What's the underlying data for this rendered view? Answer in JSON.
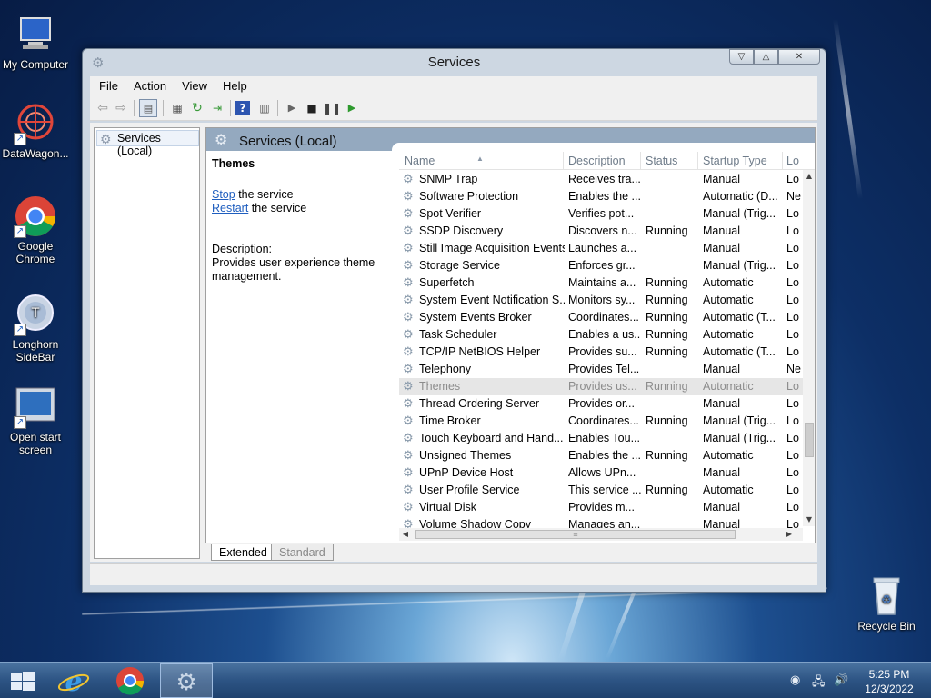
{
  "desktop": {
    "icons": [
      {
        "label": "My Computer",
        "icon": "computer-icon"
      },
      {
        "label": "DataWagon...",
        "icon": "datawagon-icon"
      },
      {
        "label": "Google Chrome",
        "icon": "chrome-icon"
      },
      {
        "label": "Longhorn SideBar",
        "icon": "sidebar-icon"
      },
      {
        "label": "Open start screen",
        "icon": "start-screen-icon"
      },
      {
        "label": "Recycle Bin",
        "icon": "recycle-bin-icon"
      }
    ]
  },
  "window": {
    "title": "Services",
    "menu": [
      "File",
      "Action",
      "View",
      "Help"
    ],
    "toolbar_icons": [
      "back-icon",
      "forward-icon",
      "show-console-tree-icon",
      "properties-icon",
      "refresh-icon",
      "export-list-icon",
      "help-icon",
      "view-icon",
      "play-icon",
      "stop-icon",
      "pause-icon",
      "resume-icon"
    ]
  },
  "tree": {
    "root_label": "Services (Local)"
  },
  "pane": {
    "title": "Services (Local)",
    "selected_service": "Themes",
    "stop_link": "Stop",
    "stop_suffix": " the service",
    "restart_link": "Restart",
    "restart_suffix": " the service",
    "description_label": "Description:",
    "description_text": "Provides user experience theme management."
  },
  "list": {
    "columns": [
      "Name",
      "Description",
      "Status",
      "Startup Type",
      "Lo"
    ],
    "rows": [
      {
        "name": "SNMP Trap",
        "desc": "Receives tra...",
        "status": "",
        "startup": "Manual",
        "logon": "Lo"
      },
      {
        "name": "Software Protection",
        "desc": "Enables the ...",
        "status": "",
        "startup": "Automatic (D...",
        "logon": "Ne"
      },
      {
        "name": "Spot Verifier",
        "desc": "Verifies pot...",
        "status": "",
        "startup": "Manual (Trig...",
        "logon": "Lo"
      },
      {
        "name": "SSDP Discovery",
        "desc": "Discovers n...",
        "status": "Running",
        "startup": "Manual",
        "logon": "Lo"
      },
      {
        "name": "Still Image Acquisition Events",
        "desc": "Launches a...",
        "status": "",
        "startup": "Manual",
        "logon": "Lo"
      },
      {
        "name": "Storage Service",
        "desc": "Enforces gr...",
        "status": "",
        "startup": "Manual (Trig...",
        "logon": "Lo"
      },
      {
        "name": "Superfetch",
        "desc": "Maintains a...",
        "status": "Running",
        "startup": "Automatic",
        "logon": "Lo"
      },
      {
        "name": "System Event Notification S...",
        "desc": "Monitors sy...",
        "status": "Running",
        "startup": "Automatic",
        "logon": "Lo"
      },
      {
        "name": "System Events Broker",
        "desc": "Coordinates...",
        "status": "Running",
        "startup": "Automatic (T...",
        "logon": "Lo"
      },
      {
        "name": "Task Scheduler",
        "desc": "Enables a us...",
        "status": "Running",
        "startup": "Automatic",
        "logon": "Lo"
      },
      {
        "name": "TCP/IP NetBIOS Helper",
        "desc": "Provides su...",
        "status": "Running",
        "startup": "Automatic (T...",
        "logon": "Lo"
      },
      {
        "name": "Telephony",
        "desc": "Provides Tel...",
        "status": "",
        "startup": "Manual",
        "logon": "Ne"
      },
      {
        "name": "Themes",
        "desc": "Provides us...",
        "status": "Running",
        "startup": "Automatic",
        "logon": "Lo",
        "selected": true
      },
      {
        "name": "Thread Ordering Server",
        "desc": "Provides or...",
        "status": "",
        "startup": "Manual",
        "logon": "Lo"
      },
      {
        "name": "Time Broker",
        "desc": "Coordinates...",
        "status": "Running",
        "startup": "Manual (Trig...",
        "logon": "Lo"
      },
      {
        "name": "Touch Keyboard and Hand...",
        "desc": "Enables Tou...",
        "status": "",
        "startup": "Manual (Trig...",
        "logon": "Lo"
      },
      {
        "name": "Unsigned Themes",
        "desc": "Enables the ...",
        "status": "Running",
        "startup": "Automatic",
        "logon": "Lo"
      },
      {
        "name": "UPnP Device Host",
        "desc": "Allows UPn...",
        "status": "",
        "startup": "Manual",
        "logon": "Lo"
      },
      {
        "name": "User Profile Service",
        "desc": "This service ...",
        "status": "Running",
        "startup": "Automatic",
        "logon": "Lo"
      },
      {
        "name": "Virtual Disk",
        "desc": "Provides m...",
        "status": "",
        "startup": "Manual",
        "logon": "Lo"
      },
      {
        "name": "Volume Shadow Copy",
        "desc": "Manages an...",
        "status": "",
        "startup": "Manual",
        "logon": "Lo"
      }
    ]
  },
  "tabs": [
    "Extended",
    "Standard"
  ],
  "taskbar": {
    "clock_time": "5:25 PM",
    "clock_date": "12/3/2022",
    "items": [
      "start-icon",
      "internet-explorer-icon",
      "chrome-icon",
      "services-icon"
    ]
  }
}
